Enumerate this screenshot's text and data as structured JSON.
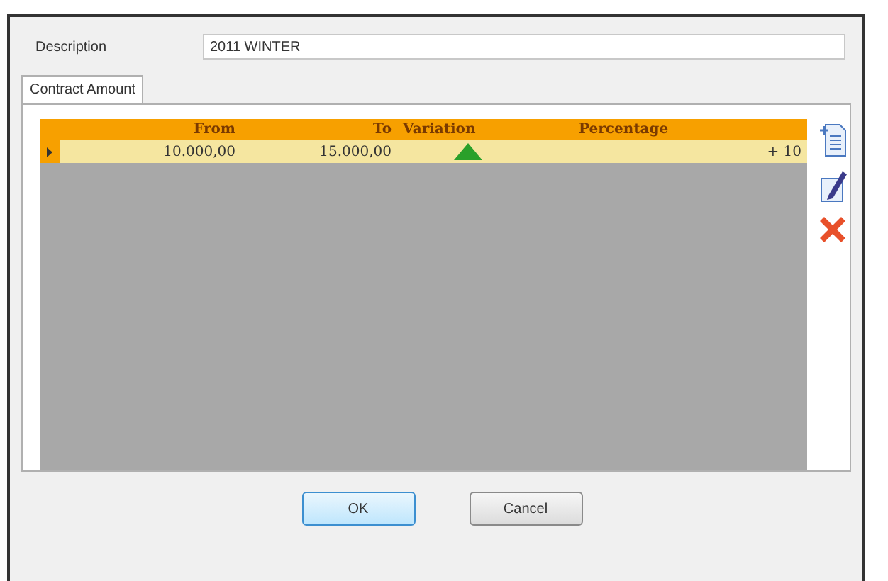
{
  "description": {
    "label": "Description",
    "value": "2011 WINTER"
  },
  "tabs": [
    {
      "label": "Contract Amount",
      "selected": true
    }
  ],
  "table": {
    "columns": [
      "From",
      "To",
      "Variation",
      "Percentage"
    ],
    "rows": [
      {
        "selected": true,
        "from": "10.000,00",
        "to": "15.000,00",
        "increase": true,
        "percentage": "+ 10"
      }
    ]
  },
  "buttons": [
    {
      "label": "OK",
      "default": true
    },
    {
      "label": "Cancel",
      "default": false
    }
  ]
}
